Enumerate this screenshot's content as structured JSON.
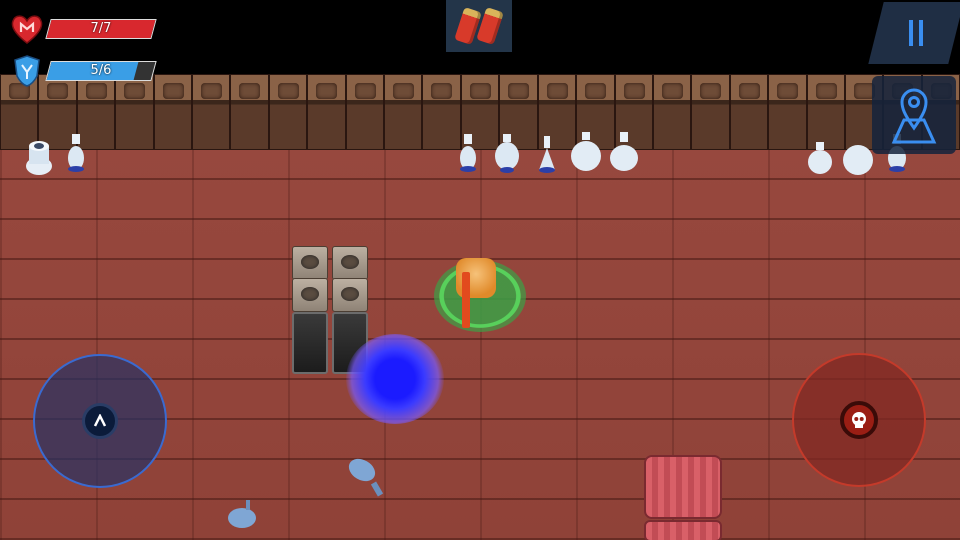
{
  "hud": {
    "health": {
      "text": "7/7",
      "fraction": 1.0,
      "color": "#d8282e",
      "icon": "heart-icon"
    },
    "shield": {
      "text": "5/6",
      "fraction": 0.8333,
      "color": "#3a9ee6",
      "icon": "shield-icon"
    }
  },
  "weapon": {
    "icon": "ammo-shells-icon"
  },
  "controls": {
    "pause": {
      "icon": "pause-icon"
    },
    "map": {
      "icon": "map-marker-icon"
    },
    "move_joystick": {
      "icon": "chevron-up-icon"
    },
    "attack_joystick": {
      "icon": "skull-icon"
    }
  },
  "colors": {
    "accent_blue": "#3a8ef0",
    "floor_brick": "#9a4a40",
    "portal": "#2a2aff",
    "player_ring": "#58d05b",
    "attack_red": "#c43a2a"
  }
}
